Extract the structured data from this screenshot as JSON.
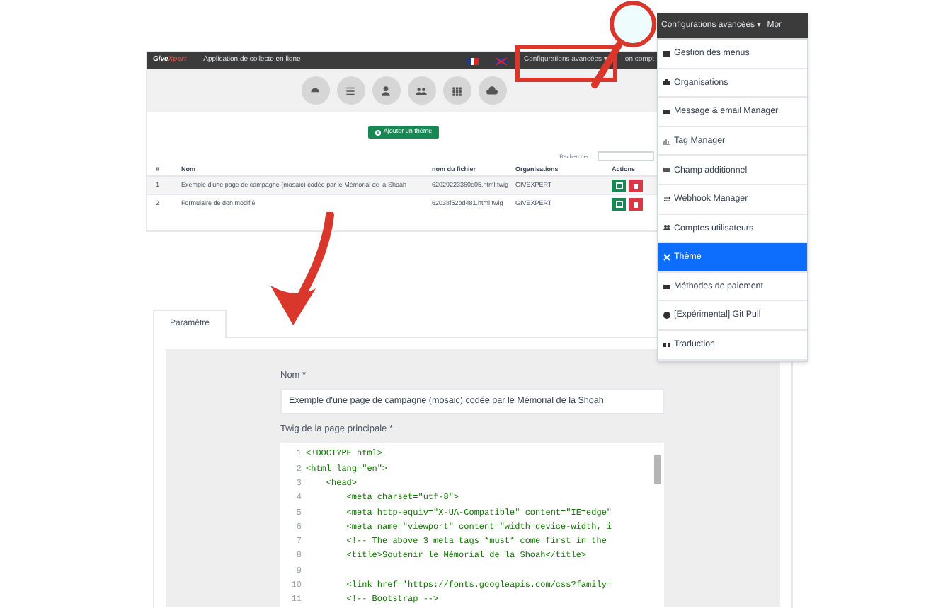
{
  "overview": {
    "brand_first": "Give",
    "brand_second": "Xpert",
    "app_title": "Application de collecte en ligne",
    "nav": [
      "Configurations avancées ▾",
      "on compt"
    ],
    "add_button": "Ajouter un thème",
    "search_label": "Rechercher :",
    "columns": [
      "#",
      "Nom",
      "nom du fichier",
      "Organisations",
      "Actions"
    ],
    "rows": [
      {
        "number": "1",
        "name": "Exemple d'une page de campagne (mosaic) codée par le Mémorial de la Shoah",
        "file": "62029223360e05.html.twig",
        "organisation": "GIVEXPERT"
      },
      {
        "number": "2",
        "name": "Formulaire de don modifié",
        "file": "62038f52bd481.html.twig",
        "organisation": "GIVEXPERT"
      }
    ]
  },
  "menu": {
    "header": "Configurations avancées ▾",
    "header_next": "Mor",
    "items": [
      {
        "label": "Gestion des menus",
        "selected": false
      },
      {
        "label": "Organisations",
        "selected": false
      },
      {
        "label": "Message & email Manager",
        "selected": false
      },
      {
        "label": "Tag Manager",
        "selected": false
      },
      {
        "label": "Champ additionnel",
        "selected": false
      },
      {
        "label": "Webhook Manager",
        "selected": false
      },
      {
        "label": "Comptes utilisateurs",
        "selected": false
      },
      {
        "label": "Thème",
        "selected": true
      },
      {
        "label": "Méthodes de paiement",
        "selected": false
      },
      {
        "label": "[Expérimental] Git Pull",
        "selected": false
      },
      {
        "label": "Traduction",
        "selected": false
      }
    ]
  },
  "form": {
    "tabs": [
      {
        "label": "Paramètre",
        "selected": true
      }
    ],
    "name_label": "Nom *",
    "name_value": "Exemple d'une page de campagne (mosaic) codée par le Mémorial de la Shoah",
    "twig_label": "Twig de la page principale *",
    "code_lines": [
      {
        "number": "1",
        "text": "<!DOCTYPE html>"
      },
      {
        "number": "2",
        "text": "<html lang=\"en\">"
      },
      {
        "number": "3",
        "text": "    <head>"
      },
      {
        "number": "4",
        "text": "        <meta charset=\"utf-8\">"
      },
      {
        "number": "5",
        "text": "        <meta http-equiv=\"X-UA-Compatible\" content=\"IE=edge\""
      },
      {
        "number": "6",
        "text": "        <meta name=\"viewport\" content=\"width=device-width, i"
      },
      {
        "number": "7",
        "text": "        <!-- The above 3 meta tags *must* come first in the"
      },
      {
        "number": "8",
        "text": "        <title>Soutenir le Mémorial de la Shoah</title>"
      },
      {
        "number": "9"
      },
      {
        "number": "10",
        "text": "        <link href='https://fonts.googleapis.com/css?family="
      },
      {
        "number": "11",
        "text": "        <!-- Bootstrap -->"
      }
    ]
  }
}
